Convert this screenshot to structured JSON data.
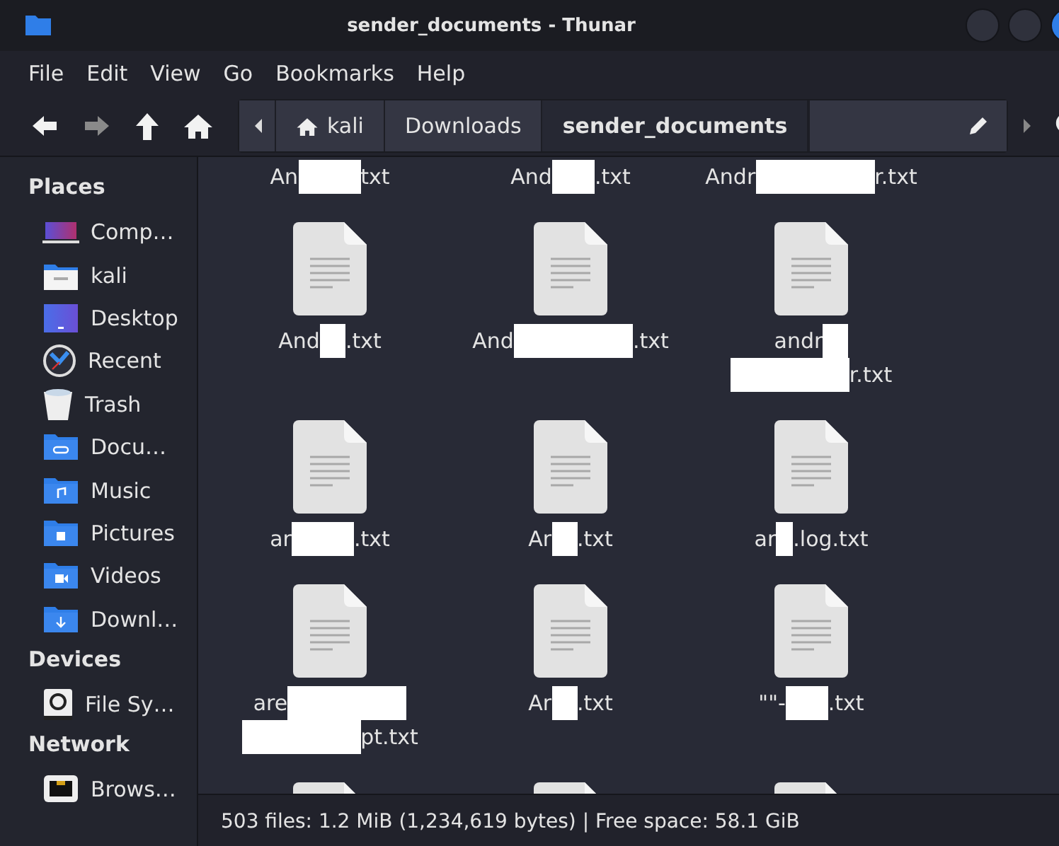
{
  "window": {
    "title": "sender_documents - Thunar"
  },
  "menu": [
    "File",
    "Edit",
    "View",
    "Go",
    "Bookmarks",
    "Help"
  ],
  "toolbar": [
    {
      "kind": "back",
      "disabled": false
    },
    {
      "kind": "forward",
      "disabled": true
    },
    {
      "kind": "up",
      "disabled": false
    },
    {
      "kind": "home",
      "disabled": false
    }
  ],
  "path_bar": [
    {
      "label": "kali",
      "kind": "home",
      "selected": false
    },
    {
      "label": "Downloads",
      "kind": "folder",
      "selected": false
    },
    {
      "label": "sender_documents",
      "kind": "folder",
      "selected": true
    }
  ],
  "sidebar": [
    {
      "header": "Places",
      "items": [
        "Comp…",
        "kali",
        "Desktop",
        "Recent",
        "Trash",
        "Docu…",
        "Music",
        "Pictures",
        "Videos",
        "Downl…"
      ]
    },
    {
      "header": "Devices",
      "items": [
        "File Sy…"
      ]
    },
    {
      "header": "Network",
      "items": [
        "Brows…"
      ]
    }
  ],
  "files": [
    {
      "kind": "text_file",
      "lines": [
        [
          {
            "kind": "text",
            "text": "An"
          },
          {
            "kind": "redaction"
          },
          {
            "kind": "text",
            "text": "txt"
          }
        ]
      ]
    },
    {
      "kind": "text_file",
      "lines": [
        [
          {
            "kind": "text",
            "text": "And"
          },
          {
            "kind": "redaction"
          },
          {
            "kind": "text",
            "text": ".txt"
          }
        ]
      ]
    },
    {
      "kind": "text_file",
      "lines": [
        [
          {
            "kind": "text",
            "text": "Andr"
          },
          {
            "kind": "redaction"
          },
          {
            "kind": "text",
            "text": "r.txt"
          }
        ]
      ]
    },
    {
      "kind": "text_file",
      "lines": [
        [
          {
            "kind": "text",
            "text": "And"
          },
          {
            "kind": "redaction"
          },
          {
            "kind": "text",
            "text": ".txt"
          }
        ]
      ]
    },
    {
      "kind": "text_file",
      "lines": [
        [
          {
            "kind": "text",
            "text": "And"
          },
          {
            "kind": "redaction"
          },
          {
            "kind": "text",
            "text": ".txt"
          }
        ]
      ]
    },
    {
      "kind": "text_file",
      "lines": [
        [
          {
            "kind": "text",
            "text": "andr"
          },
          {
            "kind": "redaction"
          }
        ],
        [
          {
            "kind": "redaction"
          },
          {
            "kind": "text",
            "text": "r.txt"
          }
        ]
      ]
    },
    {
      "kind": "text_file",
      "lines": [
        [
          {
            "kind": "text",
            "text": "ar"
          },
          {
            "kind": "redaction"
          },
          {
            "kind": "text",
            "text": ".txt"
          }
        ]
      ]
    },
    {
      "kind": "text_file",
      "lines": [
        [
          {
            "kind": "text",
            "text": "Ar"
          },
          {
            "kind": "redaction"
          },
          {
            "kind": "text",
            "text": ".txt"
          }
        ]
      ]
    },
    {
      "kind": "text_file",
      "lines": [
        [
          {
            "kind": "text",
            "text": "ar"
          },
          {
            "kind": "redaction"
          },
          {
            "kind": "text",
            "text": ".log.txt"
          }
        ]
      ]
    },
    {
      "kind": "text_file",
      "lines": [
        [
          {
            "kind": "text",
            "text": "are"
          },
          {
            "kind": "redaction"
          }
        ],
        [
          {
            "kind": "redaction"
          },
          {
            "kind": "text",
            "text": "pt.txt"
          }
        ]
      ]
    },
    {
      "kind": "text_file",
      "lines": [
        [
          {
            "kind": "text",
            "text": "Ar"
          },
          {
            "kind": "redaction"
          },
          {
            "kind": "text",
            "text": ".txt"
          }
        ]
      ]
    },
    {
      "kind": "text_file",
      "lines": [
        [
          {
            "kind": "text",
            "text": "\"\"-"
          },
          {
            "kind": "redaction"
          },
          {
            "kind": "text",
            "text": ".txt"
          }
        ]
      ]
    },
    {
      "kind": "text_file"
    },
    {
      "kind": "text_file"
    },
    {
      "kind": "text_file"
    }
  ],
  "status_bar": "503 files: 1.2 MiB (1,234,619 bytes) | Free space: 58.1 GiB"
}
